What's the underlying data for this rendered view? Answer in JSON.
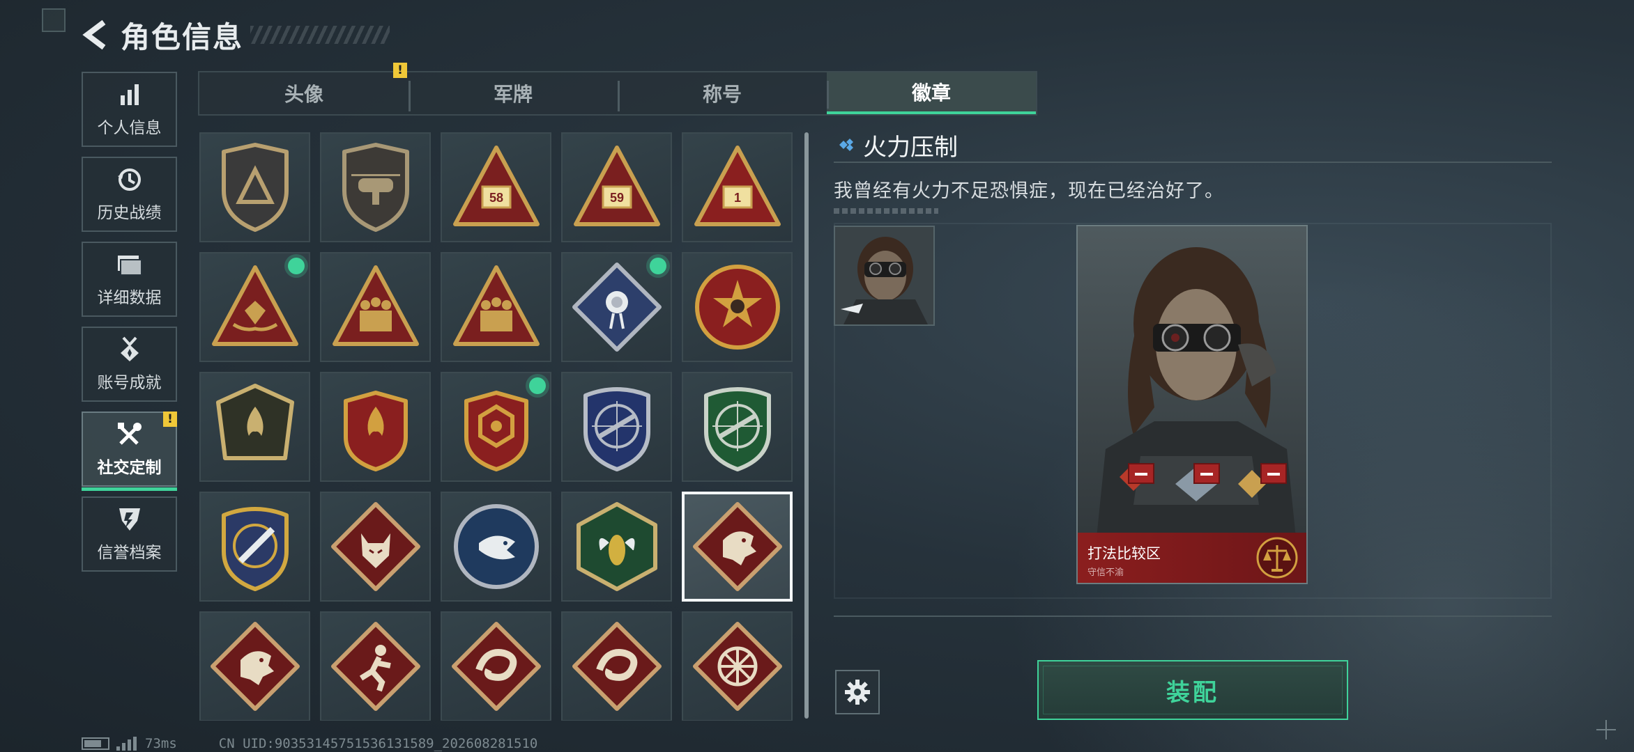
{
  "header": {
    "title": "角色信息",
    "back_icon": "back-arrow-icon"
  },
  "sidebar": {
    "items": [
      {
        "label": "个人信息",
        "icon": "bar-chart-icon",
        "active": false,
        "alert": ""
      },
      {
        "label": "历史战绩",
        "icon": "clock-history-icon",
        "active": false,
        "alert": ""
      },
      {
        "label": "详细数据",
        "icon": "folder-icon",
        "active": false,
        "alert": ""
      },
      {
        "label": "账号成就",
        "icon": "medal-icon",
        "active": false,
        "alert": ""
      },
      {
        "label": "社交定制",
        "icon": "tools-icon",
        "active": true,
        "alert": "!"
      },
      {
        "label": "信誉档案",
        "icon": "reputation-icon",
        "active": false,
        "alert": ""
      }
    ]
  },
  "tabs": [
    {
      "label": "头像",
      "active": false,
      "alert": "!"
    },
    {
      "label": "军牌",
      "active": false,
      "alert": ""
    },
    {
      "label": "称号",
      "active": false,
      "alert": ""
    },
    {
      "label": "徽章",
      "active": true,
      "alert": ""
    }
  ],
  "badges": [
    {
      "shape": "shield",
      "base": "#3a3a3a",
      "trim": "#b8a070",
      "emblem": "triangle",
      "new": false,
      "selected": false
    },
    {
      "shape": "shield",
      "base": "#3d3a36",
      "trim": "#a89876",
      "emblem": "heli",
      "new": false,
      "selected": false
    },
    {
      "shape": "triangle",
      "base": "#7a1f1f",
      "trim": "#c9a050",
      "emblem": "58",
      "new": false,
      "selected": false
    },
    {
      "shape": "triangle",
      "base": "#7a1f1f",
      "trim": "#c9a050",
      "emblem": "59",
      "new": false,
      "selected": false
    },
    {
      "shape": "triangle",
      "base": "#8a1f1f",
      "trim": "#c9a050",
      "emblem": "1",
      "new": false,
      "selected": false
    },
    {
      "shape": "triangle",
      "base": "#7a1f1f",
      "trim": "#c9a050",
      "emblem": "hands",
      "new": true,
      "selected": false
    },
    {
      "shape": "triangle",
      "base": "#7a1f1f",
      "trim": "#c9a050",
      "emblem": "soldiers",
      "new": false,
      "selected": false
    },
    {
      "shape": "triangle",
      "base": "#7a1f1f",
      "trim": "#c9a050",
      "emblem": "soldiers",
      "new": false,
      "selected": false
    },
    {
      "shape": "diamond",
      "base": "#2d3f6b",
      "trim": "#b0b6c0",
      "emblem": "rose",
      "new": true,
      "selected": false
    },
    {
      "shape": "circle",
      "base": "#8a1f1f",
      "trim": "#d2a040",
      "emblem": "star",
      "new": false,
      "selected": false
    },
    {
      "shape": "pentagon",
      "base": "#2f3226",
      "trim": "#c9b070",
      "emblem": "flame",
      "new": false,
      "selected": false
    },
    {
      "shape": "crest",
      "base": "#8a1f1f",
      "trim": "#d2a040",
      "emblem": "flame",
      "new": false,
      "selected": false
    },
    {
      "shape": "crest",
      "base": "#8a1f1f",
      "trim": "#d2a040",
      "emblem": "hex",
      "new": true,
      "selected": false
    },
    {
      "shape": "roundshield",
      "base": "#23346b",
      "trim": "#b6bcc6",
      "emblem": "rifle",
      "new": false,
      "selected": false
    },
    {
      "shape": "roundshield",
      "base": "#1f5a34",
      "trim": "#c9d2c8",
      "emblem": "rifle",
      "new": false,
      "selected": false
    },
    {
      "shape": "roundshield",
      "base": "#2b3a66",
      "trim": "#d2a840",
      "emblem": "knife",
      "new": false,
      "selected": false
    },
    {
      "shape": "diamond",
      "base": "#6a1a1a",
      "trim": "#c9a070",
      "emblem": "wolf",
      "new": false,
      "selected": false
    },
    {
      "shape": "circle",
      "base": "#1f3a5e",
      "trim": "#b0b6c0",
      "emblem": "eagle",
      "new": false,
      "selected": false
    },
    {
      "shape": "hexagon",
      "base": "#1e4a30",
      "trim": "#c9b070",
      "emblem": "wasp",
      "new": false,
      "selected": false
    },
    {
      "shape": "diamond",
      "base": "#6a1a1a",
      "trim": "#c9a070",
      "emblem": "dragon",
      "new": false,
      "selected": true
    },
    {
      "shape": "diamond",
      "base": "#6a1a1a",
      "trim": "#c9a070",
      "emblem": "dragon",
      "new": false,
      "selected": false
    },
    {
      "shape": "diamond",
      "base": "#6a1a1a",
      "trim": "#c9a070",
      "emblem": "runner",
      "new": false,
      "selected": false
    },
    {
      "shape": "diamond",
      "base": "#6a1a1a",
      "trim": "#c9a070",
      "emblem": "snake",
      "new": false,
      "selected": false
    },
    {
      "shape": "diamond",
      "base": "#6a1a1a",
      "trim": "#c9a070",
      "emblem": "snake",
      "new": false,
      "selected": false
    },
    {
      "shape": "diamond",
      "base": "#6a1a1a",
      "trim": "#c9a070",
      "emblem": "wheel",
      "new": false,
      "selected": false
    }
  ],
  "detail": {
    "name": "火力压制",
    "description": "我曾经有火力不足恐惧症，现在已经治好了。",
    "card_title": "打法比较区",
    "card_subtitle": "守信不渝",
    "equip_label": "装配",
    "settings_icon": "gear-icon"
  },
  "status": {
    "ping": "73ms",
    "uid": "CN UID:90353145751536131589_202608281510"
  },
  "colors": {
    "accent": "#3fd39a",
    "alert": "#f0c838",
    "card_red": "#8b1e1e"
  }
}
